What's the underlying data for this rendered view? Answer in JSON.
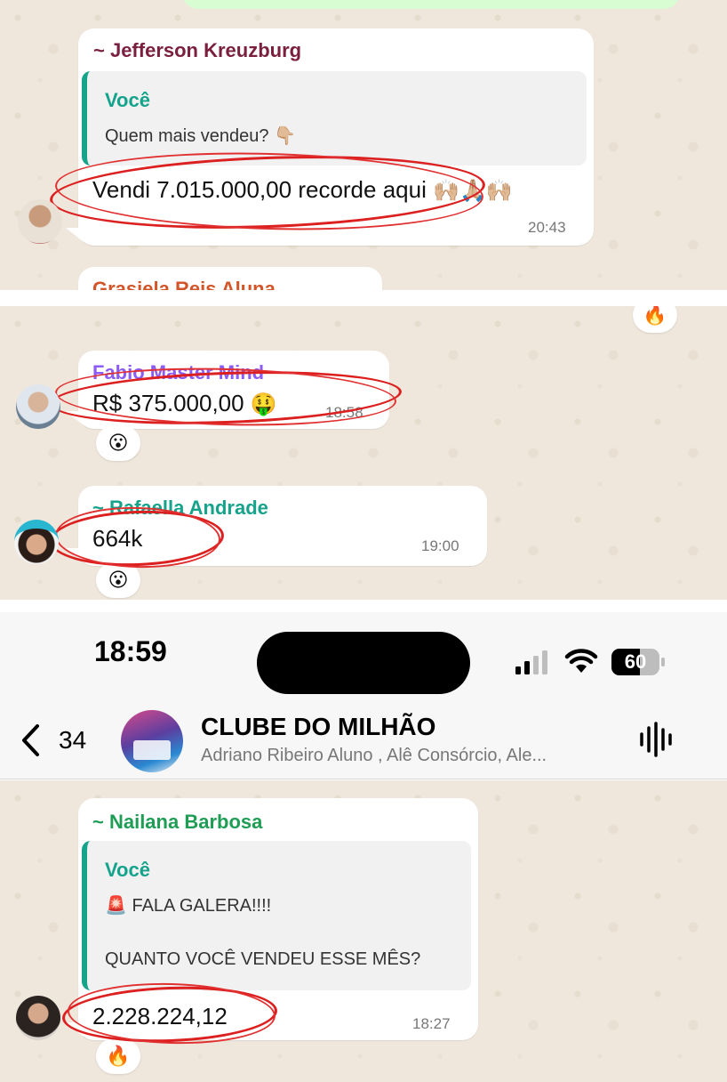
{
  "panel1": {
    "sender": "~ Jefferson Kreuzburg",
    "quote_name": "Você",
    "quote_text": "Quem mais vendeu?",
    "quote_emoji": "👇🏼",
    "message": "Vendi 7.015.000,00 recorde aqui",
    "message_emoji": "🙌🏼🙏🏼🙌🏼",
    "time": "20:43",
    "next_sender_partial": "Grasiela Reis Aluna"
  },
  "panel2": {
    "top_reaction": "🔥",
    "msg1": {
      "sender": "Fabio Master Mind",
      "message": "R$ 375.000,00",
      "message_emoji": "🤑",
      "time": "18:58",
      "reaction": "😮"
    },
    "msg2": {
      "sender": "~ Rafaella Andrade",
      "message": "664k",
      "time": "19:00",
      "reaction": "😮"
    }
  },
  "header": {
    "status_time": "18:59",
    "battery_level": "60",
    "battery_fraction": 0.6,
    "back_count": "34",
    "group_title": "CLUBE DO MILHÃO",
    "group_subtitle": "Adriano Ribeiro Aluno , Alê Consórcio, Ale...",
    "icons": [
      "chevron-left-icon",
      "signal-icon",
      "wifi-icon",
      "battery-icon",
      "audio-waveform-icon"
    ]
  },
  "panel3": {
    "sender": "~ Nailana Barbosa",
    "quote_name": "Você",
    "quote_line1_emoji": "🚨",
    "quote_line1": "FALA GALERA!!!!",
    "quote_line2": "QUANTO VOCÊ VENDEU ESSE MÊS?",
    "message": "2.228.224,12",
    "time": "18:27",
    "reaction": "🔥"
  },
  "colors": {
    "chat_bg": "#efe7dc",
    "highlight_circle": "#dc1f1f",
    "sender_jefferson": "#7a1f3d",
    "sender_fabio": "#8b5cf6",
    "sender_green": "#15a38b",
    "sender_nailana": "#1f9d55"
  }
}
